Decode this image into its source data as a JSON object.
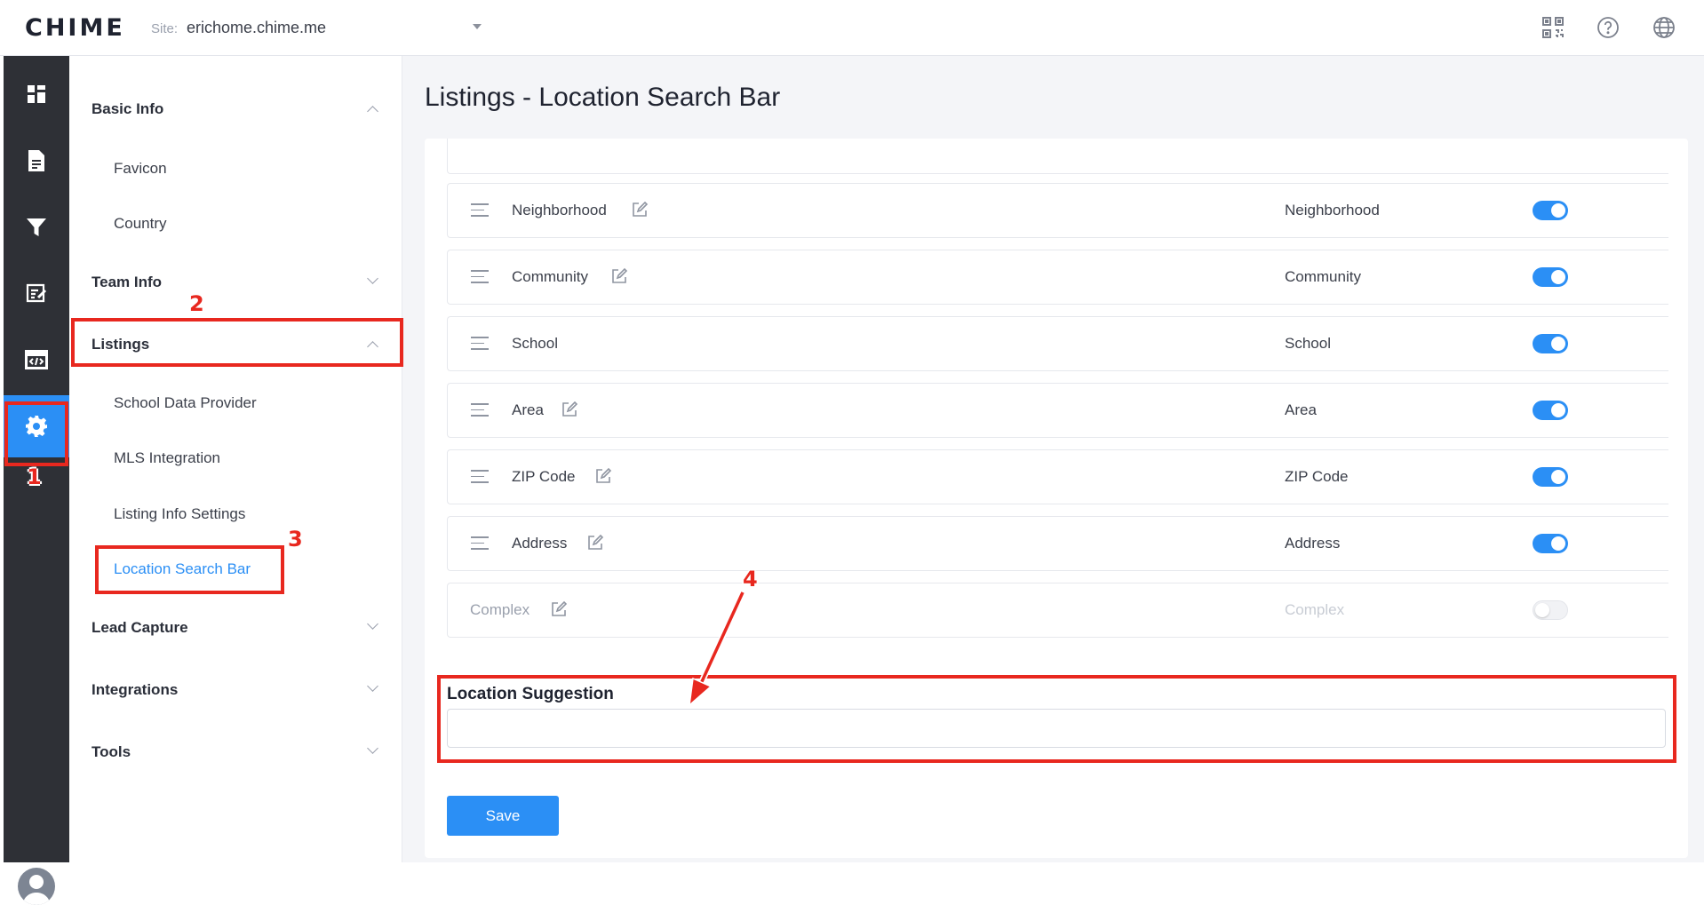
{
  "app": {
    "logo": "CHIME"
  },
  "topbar": {
    "site_label": "Site:",
    "site_value": "erichome.chime.me",
    "icons": [
      "qr-code-icon",
      "help-icon",
      "globe-icon"
    ]
  },
  "rail": {
    "items": [
      "dashboard-icon",
      "document-icon",
      "filter-icon",
      "edit-note-icon",
      "code-icon",
      "settings-icon"
    ],
    "active": "settings-icon"
  },
  "submenu": {
    "groups": [
      {
        "label": "Basic Info",
        "expanded": true,
        "items": [
          "Favicon",
          "Country"
        ]
      },
      {
        "label": "Team Info",
        "expanded": false
      },
      {
        "label": "Listings",
        "expanded": true,
        "items": [
          "School Data Provider",
          "MLS Integration",
          "Listing Info Settings",
          "Location Search Bar"
        ]
      },
      {
        "label": "Lead Capture",
        "expanded": false
      },
      {
        "label": "Integrations",
        "expanded": false
      },
      {
        "label": "Tools",
        "expanded": false
      }
    ],
    "active_item": "Location Search Bar"
  },
  "main": {
    "title": "Listings - Location Search Bar",
    "rows": [
      {
        "name": "Neighborhood",
        "value": "Neighborhood",
        "enabled": true
      },
      {
        "name": "Community",
        "value": "Community",
        "enabled": true
      },
      {
        "name": "School",
        "value": "School",
        "enabled": true
      },
      {
        "name": "Area",
        "value": "Area",
        "enabled": true
      },
      {
        "name": "ZIP Code",
        "value": "ZIP Code",
        "enabled": true
      },
      {
        "name": "Address",
        "value": "Address",
        "enabled": true
      },
      {
        "name": "Complex",
        "value": "Complex",
        "enabled": false
      }
    ],
    "location_suggestion_label": "Location Suggestion",
    "location_suggestion_value": "",
    "save_label": "Save"
  },
  "annotations": {
    "n1": "1",
    "n2": "2",
    "n3": "3",
    "n4": "4"
  },
  "colors": {
    "accent": "#2b8ff5",
    "annotation": "#e8281f",
    "rail": "#2e3036"
  }
}
